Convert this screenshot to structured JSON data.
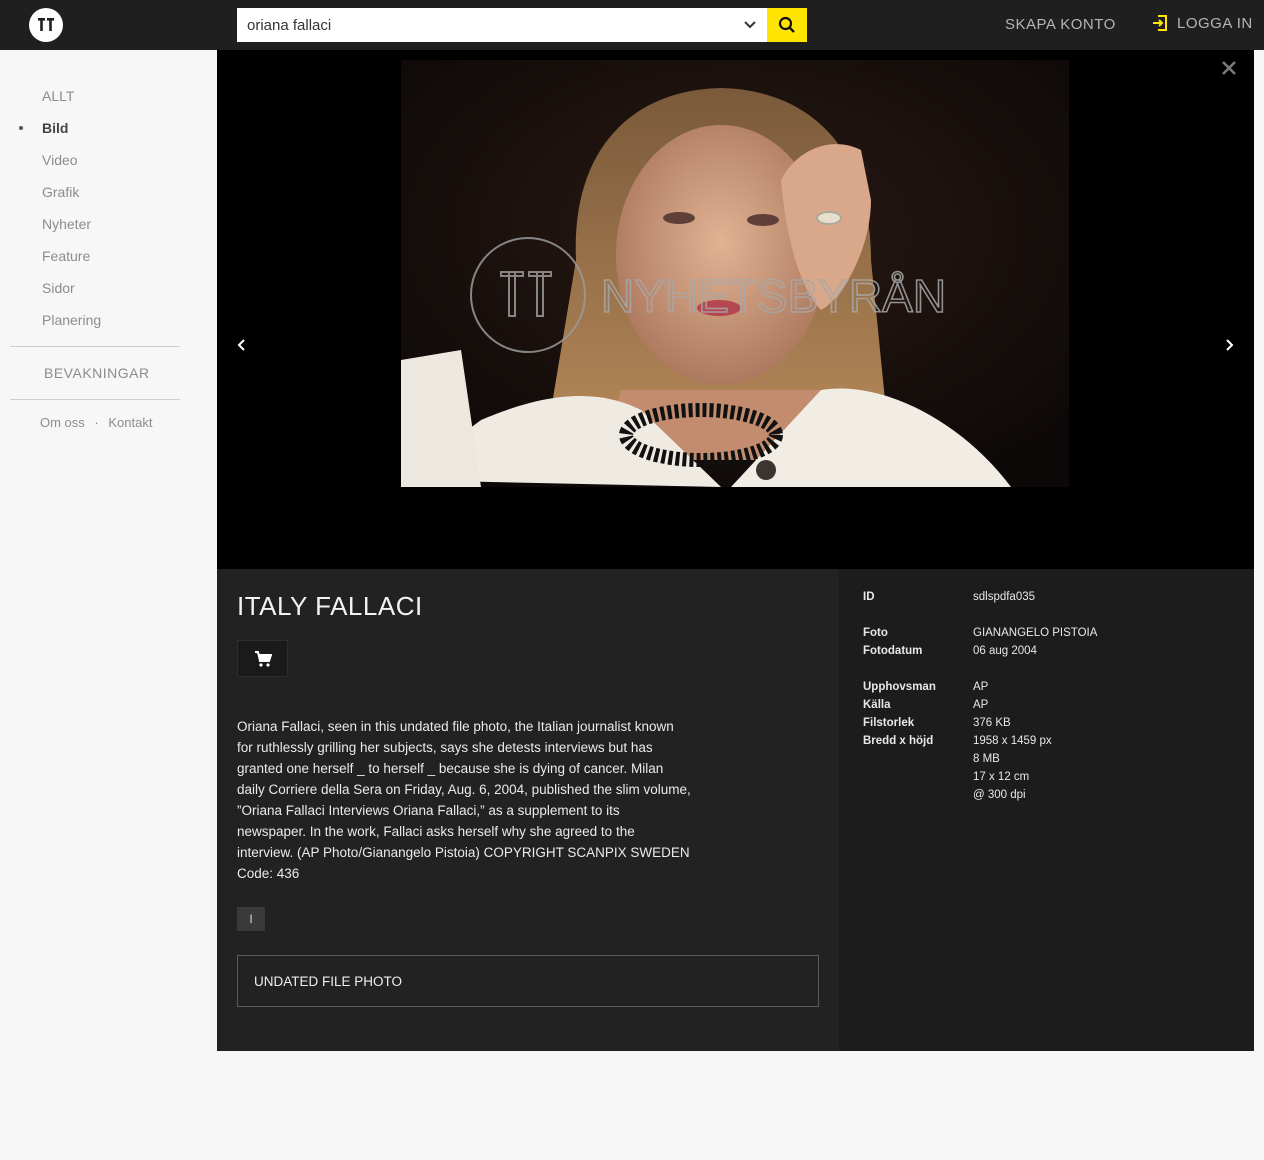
{
  "header": {
    "search_value": "oriana fallaci",
    "skapa_konto": "SKAPA KONTO",
    "logga_in": "LOGGA IN"
  },
  "sidebar": {
    "items": [
      {
        "label": "ALLT"
      },
      {
        "label": "Bild"
      },
      {
        "label": "Video"
      },
      {
        "label": "Grafik"
      },
      {
        "label": "Nyheter"
      },
      {
        "label": "Feature"
      },
      {
        "label": "Sidor"
      },
      {
        "label": "Planering"
      }
    ],
    "active_index": 1,
    "bevakningar": "BEVAKNINGAR",
    "footer": {
      "about": "Om oss",
      "separator": "·",
      "contact": "Kontakt"
    }
  },
  "viewer": {
    "watermark": "NYHETSBYRÅN"
  },
  "detail": {
    "title": "ITALY FALLACI",
    "caption": "Oriana Fallaci, seen in this undated file photo, the Italian journalist known for ruthlessly grilling her subjects, says she detests interviews but has granted one herself _ to herself _ because she is dying of cancer. Milan daily Corriere della Sera on Friday, Aug. 6, 2004, published the slim volume, ”Oriana Fallaci Interviews Oriana Fallaci,” as a supplement to its newspaper. In the work, Fallaci asks herself why she agreed to the interview. (AP Photo/Gianangelo Pistoia) COPYRIGHT SCANPIX SWEDEN Code: 436",
    "tag": "I",
    "keyword": "UNDATED FILE PHOTO"
  },
  "meta": {
    "id_label": "ID",
    "id_value": "sdlspdfa035",
    "foto_label": "Foto",
    "foto_value": "GIANANGELO PISTOIA",
    "fotodatum_label": "Fotodatum",
    "fotodatum_value": "06 aug 2004",
    "upphovsman_label": "Upphovsman",
    "upphovsman_value": "AP",
    "kalla_label": "Källa",
    "kalla_value": "AP",
    "filstorlek_label": "Filstorlek",
    "filstorlek_value": "376 KB",
    "bredd_label": "Bredd x höjd",
    "bredd_value": "1958 x 1459 px",
    "mb_value": "8 MB",
    "cm_value": "17 x 12 cm",
    "dpi_value": "@ 300 dpi"
  },
  "colors": {
    "topbar": "#1f1f1f",
    "search_button": "#ffe500",
    "login_icon": "#ffe500",
    "panel_left": "#222222",
    "panel_right": "#1c1c1c"
  },
  "icons": [
    "logo-icon",
    "chevron-down-icon",
    "search-icon",
    "login-icon",
    "close-icon",
    "chevron-left-icon",
    "chevron-right-icon",
    "cart-icon"
  ]
}
